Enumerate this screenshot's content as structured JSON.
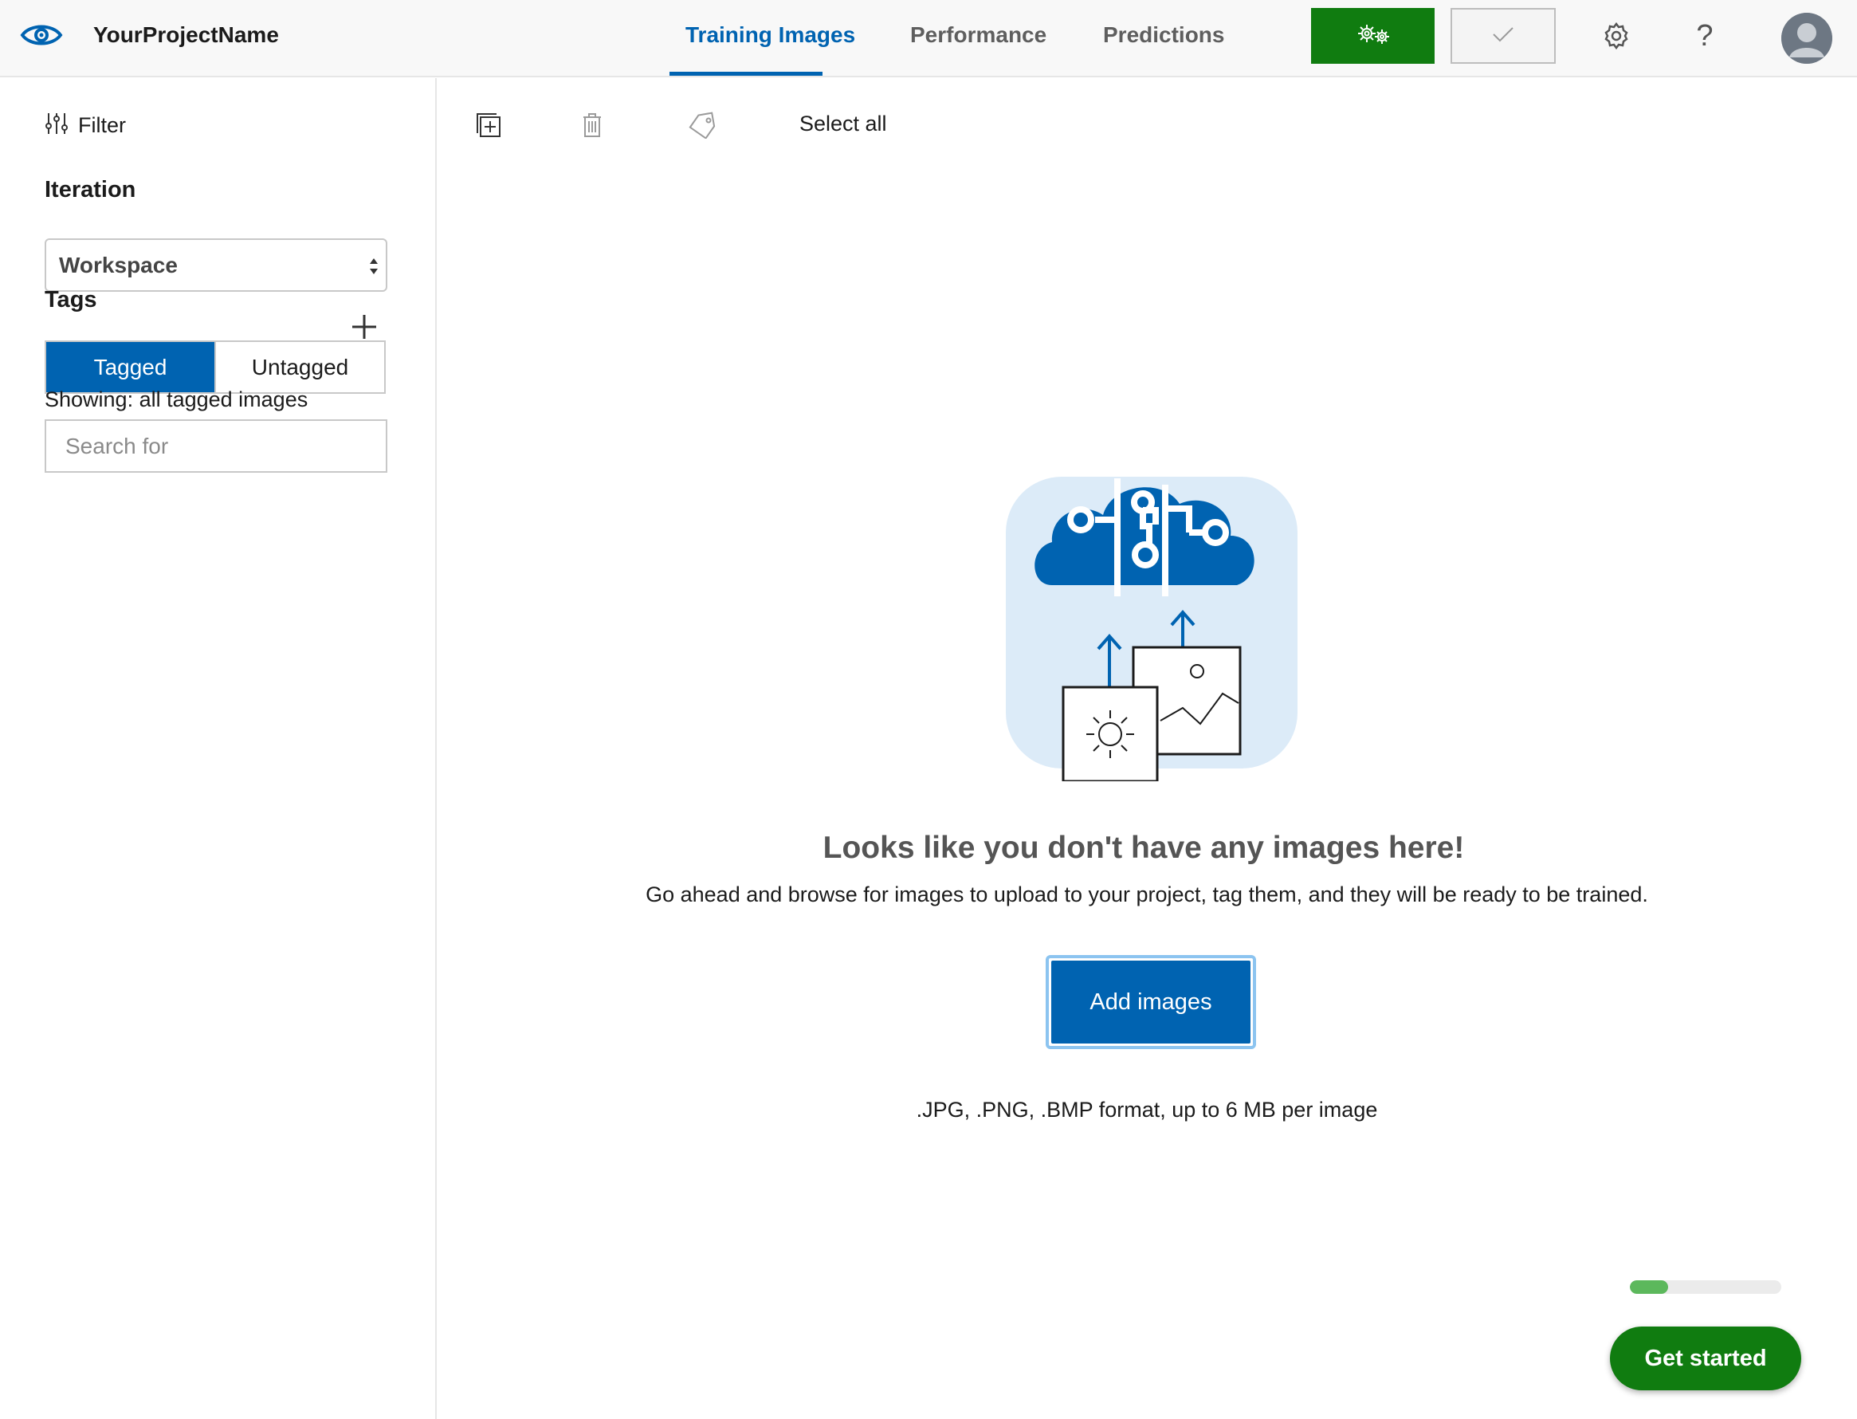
{
  "header": {
    "project_name": "YourProjectName",
    "tabs": [
      {
        "label": "Training Images",
        "active": true
      },
      {
        "label": "Performance",
        "active": false
      },
      {
        "label": "Predictions",
        "active": false
      }
    ],
    "train_icon": "gears-icon",
    "quick_test_icon": "checkmark-icon",
    "settings_icon": "gear-icon",
    "help_label": "?",
    "accent_color": "#0063b1",
    "train_color": "#107c10"
  },
  "sidebar": {
    "filter_label": "Filter",
    "iteration_title": "Iteration",
    "iteration_value": "Workspace",
    "tags_title": "Tags",
    "toggle": {
      "tagged": "Tagged",
      "untagged": "Untagged",
      "selected": "Tagged"
    },
    "showing_text": "Showing: all tagged images",
    "search_placeholder": "Search for"
  },
  "toolbar": {
    "icons": [
      "add-images-icon",
      "trash-icon",
      "tag-icon"
    ],
    "select_all_label": "Select all"
  },
  "empty_state": {
    "title": "Looks like you don't have any images here!",
    "description": "Go ahead and browse for images to upload to your project, tag them, and they will be ready to be trained.",
    "add_button_label": "Add images",
    "format_note": ".JPG, .PNG, .BMP format, up to 6 MB per image"
  },
  "onboarding": {
    "progress_fraction": 0.25,
    "get_started_label": "Get started"
  }
}
